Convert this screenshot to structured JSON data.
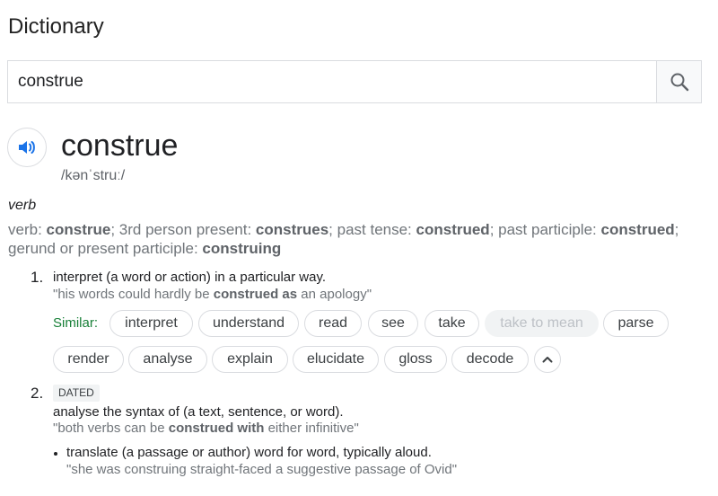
{
  "page_title": "Dictionary",
  "search": {
    "value": "construe",
    "placeholder": ""
  },
  "entry": {
    "word": "construe",
    "phonetic": "/kənˈstruː/",
    "part_of_speech": "verb",
    "forms": {
      "verb_label": "verb: ",
      "verb": "construe",
      "third_label": "; 3rd person present: ",
      "third": "construes",
      "past_label": "; past tense: ",
      "past": "construed",
      "pp_label": "; past participle: ",
      "pp": "construed",
      "ger_label": "; gerund or present participle: ",
      "ger": "construing"
    },
    "senses": [
      {
        "number": "1.",
        "definition": "interpret (a word or action) in a particular way.",
        "example_pre": "\"his words could hardly be ",
        "example_bold": "construed as",
        "example_post": " an apology\"",
        "similar_label": "Similar:",
        "similar": [
          "interpret",
          "understand",
          "read",
          "see",
          "take",
          "take to mean",
          "parse",
          "render",
          "analyse",
          "explain",
          "elucidate",
          "gloss",
          "decode"
        ]
      },
      {
        "number": "2.",
        "label": "DATED",
        "definition": "analyse the syntax of (a text, sentence, or word).",
        "example_pre": "\"both verbs can be ",
        "example_bold": "construed with",
        "example_post": " either infinitive\"",
        "subsense": {
          "definition": "translate (a passage or author) word for word, typically aloud.",
          "example": "\"she was construing straight-faced a suggestive passage of Ovid\""
        }
      }
    ]
  },
  "icons": {
    "search": "search-icon",
    "speaker": "speaker-icon",
    "collapse": "chevron-up-icon"
  },
  "colors": {
    "accent_blue": "#1a73e8",
    "similar_green": "#188038"
  }
}
